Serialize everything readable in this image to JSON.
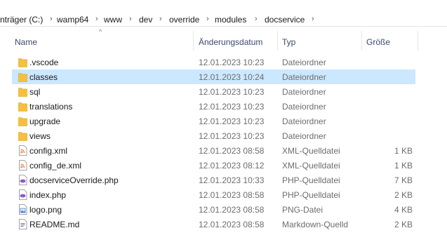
{
  "breadcrumb": {
    "items": [
      "nträger (C:)",
      "wamp64",
      "www",
      "dev",
      "override",
      "modules",
      "docservice"
    ],
    "separator": "›"
  },
  "columns": {
    "name": "Name",
    "date": "Änderungsdatum",
    "type": "Typ",
    "size": "Größe"
  },
  "colors": {
    "folder": "#f5c13d",
    "selected": "#cce8ff",
    "xml": "#e8722c",
    "php": "#8a5cc7",
    "png": "#3a7bd5"
  },
  "files": [
    {
      "name": ".vscode",
      "date": "12.01.2023 10:23",
      "type": "Dateiordner",
      "size": "",
      "icon": "folder-icon"
    },
    {
      "name": "classes",
      "date": "12.01.2023 10:24",
      "type": "Dateiordner",
      "size": "",
      "icon": "folder-icon",
      "selected": true
    },
    {
      "name": "sql",
      "date": "12.01.2023 10:23",
      "type": "Dateiordner",
      "size": "",
      "icon": "folder-icon"
    },
    {
      "name": "translations",
      "date": "12.01.2023 10:23",
      "type": "Dateiordner",
      "size": "",
      "icon": "folder-icon"
    },
    {
      "name": "upgrade",
      "date": "12.01.2023 10:23",
      "type": "Dateiordner",
      "size": "",
      "icon": "folder-icon"
    },
    {
      "name": "views",
      "date": "12.01.2023 10:23",
      "type": "Dateiordner",
      "size": "",
      "icon": "folder-icon"
    },
    {
      "name": "config.xml",
      "date": "12.01.2023 08:58",
      "type": "XML-Quelldatei",
      "size": "1 KB",
      "icon": "xml-file-icon"
    },
    {
      "name": "config_de.xml",
      "date": "12.01.2023 08:12",
      "type": "XML-Quelldatei",
      "size": "1 KB",
      "icon": "xml-file-icon"
    },
    {
      "name": "docserviceOverride.php",
      "date": "12.01.2023 10:33",
      "type": "PHP-Quelldatei",
      "size": "7 KB",
      "icon": "php-file-icon"
    },
    {
      "name": "index.php",
      "date": "12.01.2023 08:58",
      "type": "PHP-Quelldatei",
      "size": "2 KB",
      "icon": "php-file-icon"
    },
    {
      "name": "logo.png",
      "date": "12.01.2023 08:58",
      "type": "PNG-Datei",
      "size": "4 KB",
      "icon": "image-file-icon"
    },
    {
      "name": "README.md",
      "date": "12.01.2023 08:58",
      "type": "Markdown-Quelld",
      "size": "2 KB",
      "icon": "markdown-file-icon"
    }
  ]
}
